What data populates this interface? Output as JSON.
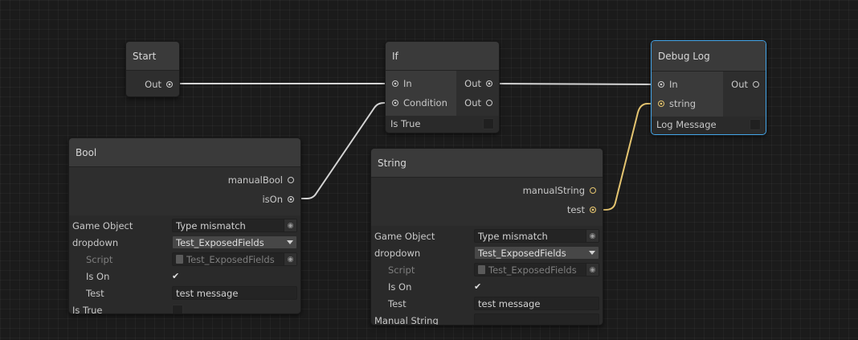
{
  "nodes": {
    "start": {
      "title": "Start",
      "out_label": "Out"
    },
    "if": {
      "title": "If",
      "in_label": "In",
      "condition_label": "Condition",
      "out_true_label": "Out",
      "out_false_label": "Out",
      "footer_label": "Is True"
    },
    "debug_log": {
      "title": "Debug Log",
      "in_label": "In",
      "string_label": "string",
      "out_label": "Out",
      "footer_label": "Log Message"
    },
    "bool": {
      "title": "Bool",
      "manual_label": "manualBool",
      "ison_label": "isOn",
      "game_object_label": "Game Object",
      "game_object_value": "Type mismatch",
      "dropdown_label": "dropdown",
      "dropdown_value": "Test_ExposedFields",
      "script_label": "Script",
      "script_value": "Test_ExposedFields",
      "is_on_label": "Is On",
      "test_label": "Test",
      "test_value": "test message",
      "footer_label": "Is True"
    },
    "string": {
      "title": "String",
      "manual_label": "manualString",
      "test_port_label": "test",
      "game_object_label": "Game Object",
      "game_object_value": "Type mismatch",
      "dropdown_label": "dropdown",
      "dropdown_value": "Test_ExposedFields",
      "script_label": "Script",
      "script_value": "Test_ExposedFields",
      "is_on_label": "Is On",
      "test_label": "Test",
      "test_value": "test message",
      "footer_label": "Manual String"
    }
  },
  "colors": {
    "flow_wire": "#d4d4d4",
    "string_wire": "#e4c470",
    "selected_border": "#44a5e8"
  }
}
